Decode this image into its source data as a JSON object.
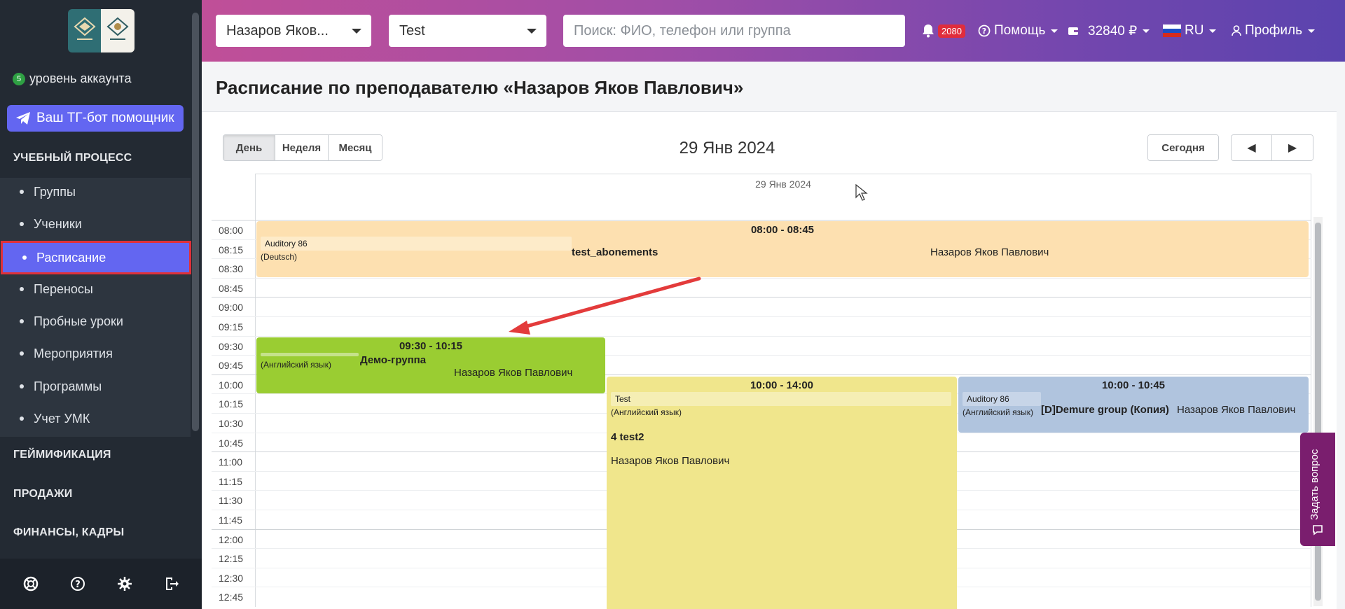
{
  "sidebar": {
    "level_num": "5",
    "level_text": "уровень аккаунта",
    "tg_button": "Ваш ТГ-бот помощник",
    "section_learning": "УЧЕБНЫЙ ПРОЦЕСС",
    "items": [
      {
        "label": "Группы"
      },
      {
        "label": "Ученики"
      },
      {
        "label": "Расписание"
      },
      {
        "label": "Переносы"
      },
      {
        "label": "Пробные уроки"
      },
      {
        "label": "Мероприятия"
      },
      {
        "label": "Программы"
      },
      {
        "label": "Учет УМК"
      }
    ],
    "section_gamification": "ГЕЙМИФИКАЦИЯ",
    "section_sales": "ПРОДАЖИ",
    "section_finance": "ФИНАНСЫ, КАДРЫ",
    "bottom_icons": [
      "support-icon",
      "help-icon",
      "settings-icon",
      "logout-icon"
    ]
  },
  "topbar": {
    "teacher_select": "Назаров Яков...",
    "branch_select": "Test",
    "search_placeholder": "Поиск: ФИО, телефон или группа",
    "notif_count": "2080",
    "help": "Помощь",
    "balance": "32840 ₽",
    "lang": "RU",
    "profile": "Профиль"
  },
  "page": {
    "title": "Расписание по преподавателю «Назаров Яков Павлович»"
  },
  "calendar": {
    "views": [
      "День",
      "Неделя",
      "Месяц"
    ],
    "active_view": "День",
    "date": "29 Янв 2024",
    "column_header": "29 Янв 2024",
    "today": "Сегодня",
    "prev": "◀",
    "next": "▶",
    "times": [
      "08:00",
      "08:15",
      "08:30",
      "08:45",
      "09:00",
      "09:15",
      "09:30",
      "09:45",
      "10:00",
      "10:15",
      "10:30",
      "10:45",
      "11:00",
      "11:15",
      "11:30",
      "11:45",
      "12:00",
      "12:15",
      "12:30",
      "12:45"
    ],
    "events": [
      {
        "time": "08:00 - 08:45",
        "room": "Auditory 86",
        "subject": "(Deutsch)",
        "group": "test_abonements",
        "teacher": "Назаров Яков Павлович",
        "color": "#fde0b0"
      },
      {
        "time": "09:30 - 10:15",
        "room": "",
        "subject": "(Английский язык)",
        "group": "Демо-группа",
        "teacher": "Назаров Яков Павлович",
        "color": "#9acd32"
      },
      {
        "time": "10:00 - 14:00",
        "room": "Test",
        "subject": "(Английский язык)",
        "group": "4 test2",
        "teacher": "Назаров Яков Павлович",
        "color": "#f0e68c"
      },
      {
        "time": "10:00 - 10:45",
        "room": "Auditory 86",
        "subject": "(Английский язык)",
        "group": "[D]Demure group (Копия)",
        "teacher": "Назаров Яков Павлович",
        "color": "#b0c4de"
      }
    ]
  },
  "ask_question": "Задать вопрос"
}
